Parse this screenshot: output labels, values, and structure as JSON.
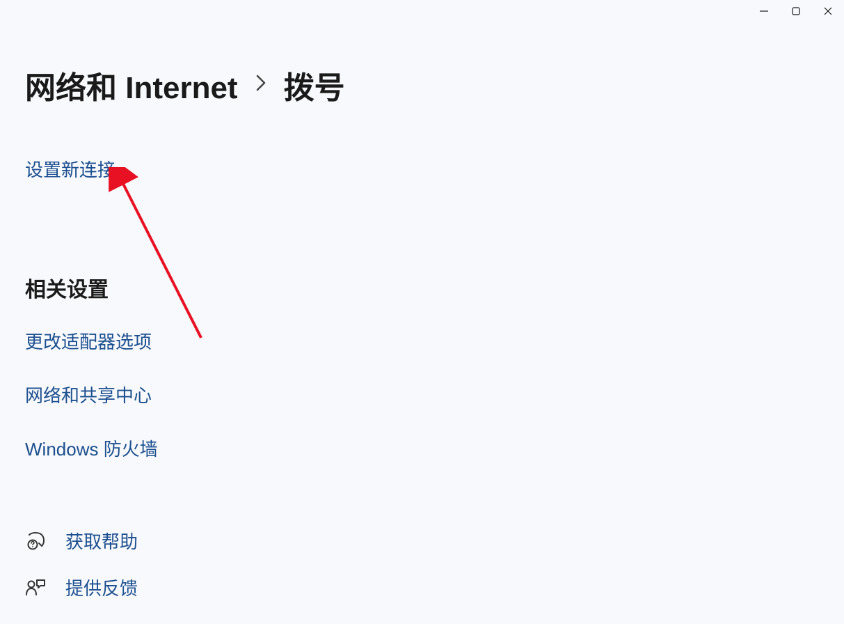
{
  "breadcrumb": {
    "root": "网络和 Internet",
    "current": "拨号"
  },
  "links": {
    "setupNewConnection": "设置新连接"
  },
  "relatedSettings": {
    "heading": "相关设置",
    "items": [
      "更改适配器选项",
      "网络和共享中心",
      "Windows 防火墙"
    ]
  },
  "help": {
    "getHelp": "获取帮助",
    "giveFeedback": "提供反馈"
  }
}
